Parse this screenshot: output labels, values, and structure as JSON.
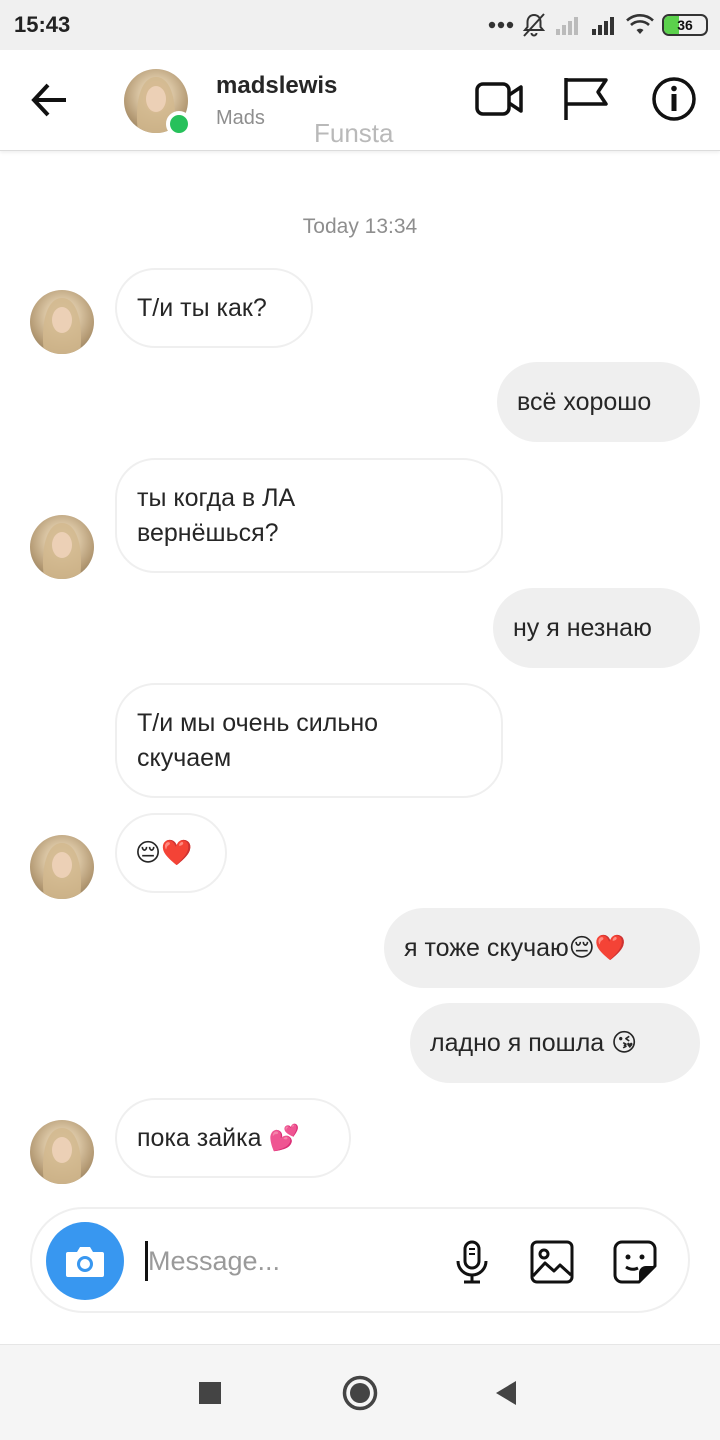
{
  "status_bar": {
    "time": "15:43",
    "battery_level": "36",
    "battery_fraction": 0.36,
    "icons": [
      "more-dots-icon",
      "notifications-off-icon",
      "signal-weak-icon",
      "signal-icon",
      "wifi-icon",
      "battery-icon"
    ]
  },
  "header": {
    "username": "madslewis",
    "display_name": "Mads",
    "tag": "Funsta",
    "online": true,
    "icons": [
      "back-arrow-icon",
      "video-call-icon",
      "flag-icon",
      "info-icon"
    ]
  },
  "chat": {
    "timestamp": "Today 13:34",
    "messages": [
      {
        "direction": "in",
        "text": "Т/и ты как?"
      },
      {
        "direction": "out",
        "text": "всё хорошо"
      },
      {
        "direction": "in",
        "lines": [
          "ты когда в ЛА",
          "вернёшься?"
        ]
      },
      {
        "direction": "out",
        "text": "ну я незнаю"
      },
      {
        "direction": "in",
        "lines": [
          "Т/и мы очень сильно",
          "скучаем"
        ]
      },
      {
        "direction": "in",
        "text": "😔❤️"
      },
      {
        "direction": "out",
        "text": "я тоже скучаю😔❤️"
      },
      {
        "direction": "out",
        "text": "ладно я пошла 😘"
      },
      {
        "direction": "in",
        "text": "пока зайка 💕"
      }
    ]
  },
  "composer": {
    "placeholder": "Message...",
    "icons": [
      "camera-icon",
      "microphone-icon",
      "gallery-icon",
      "sticker-icon"
    ]
  },
  "nav_bar": {
    "icons": [
      "recents-square-icon",
      "home-circle-icon",
      "back-triangle-icon"
    ]
  },
  "colors": {
    "accent_blue": "#3897f0",
    "online_green": "#27c15b",
    "bubble_out": "#efefef",
    "text_primary": "#262626",
    "text_secondary": "#8e8e8e"
  }
}
